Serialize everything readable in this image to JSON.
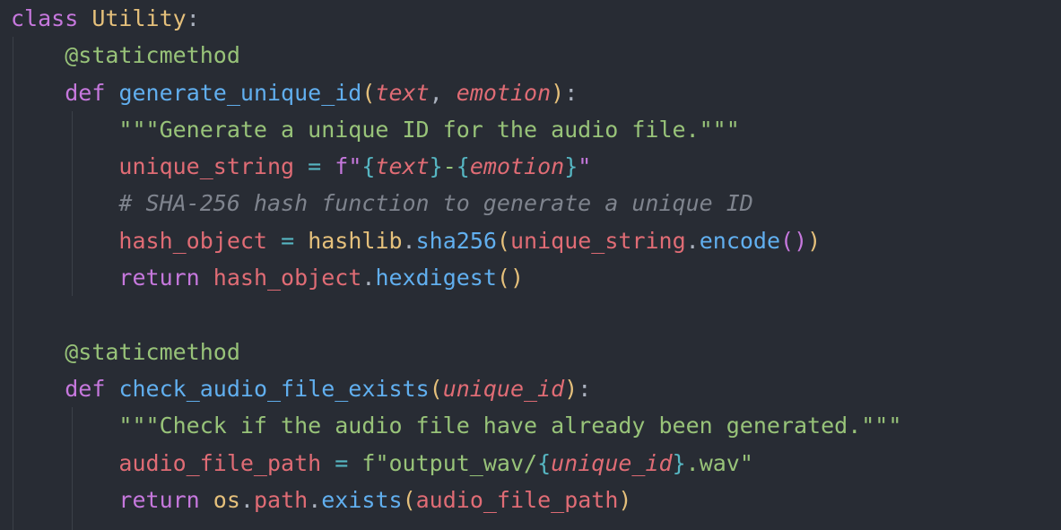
{
  "code": {
    "line1": {
      "kw": "class",
      "name": "Utility",
      "colon": ":"
    },
    "line2": {
      "decorator": "@staticmethod"
    },
    "line3": {
      "kw": "def",
      "fn": "generate_unique_id",
      "lparen": "(",
      "p1": "text",
      "comma": ",",
      "p2": "emotion",
      "rparen": ")",
      "colon": ":"
    },
    "line4": {
      "doc": "\"\"\"Generate a unique ID for the audio file.\"\"\""
    },
    "line5": {
      "var": "unique_string",
      "eq": "=",
      "prefix": "f\"",
      "lb1": "{",
      "p1": "text",
      "rb1": "}",
      "dash": "-",
      "lb2": "{",
      "p2": "emotion",
      "rb2": "}",
      "quote": "\""
    },
    "line6": {
      "comment": "# SHA-256 hash function to generate a unique ID"
    },
    "line7": {
      "var": "hash_object",
      "eq": "=",
      "mod": "hashlib",
      "dot": ".",
      "fn": "sha256",
      "lparen": "(",
      "arg": "unique_string",
      "dot2": ".",
      "fn2": "encode",
      "inner": "()",
      "rparen": ")"
    },
    "line8": {
      "kw": "return",
      "var": "hash_object",
      "dot": ".",
      "fn": "hexdigest",
      "parens": "()"
    },
    "line10": {
      "decorator": "@staticmethod"
    },
    "line11": {
      "kw": "def",
      "fn": "check_audio_file_exists",
      "lparen": "(",
      "p1": "unique_id",
      "rparen": ")",
      "colon": ":"
    },
    "line12": {
      "doc": "\"\"\"Check if the audio file have already been generated.\"\"\""
    },
    "line13": {
      "var": "audio_file_path",
      "eq": "=",
      "prefix": "f\"output_wav/",
      "lb": "{",
      "p1": "unique_id",
      "rb": "}",
      "suffix": ".wav\""
    },
    "line14": {
      "kw": "return",
      "mod": "os",
      "dot": ".",
      "attr": "path",
      "dot2": ".",
      "fn": "exists",
      "lparen": "(",
      "arg": "audio_file_path",
      "rparen": ")"
    }
  },
  "colors": {
    "background": "#282c34",
    "keyword": "#c678dd",
    "function": "#61afef",
    "string": "#98c379",
    "variable": "#e06c75",
    "class": "#e5c07b",
    "comment": "#7f848e"
  }
}
